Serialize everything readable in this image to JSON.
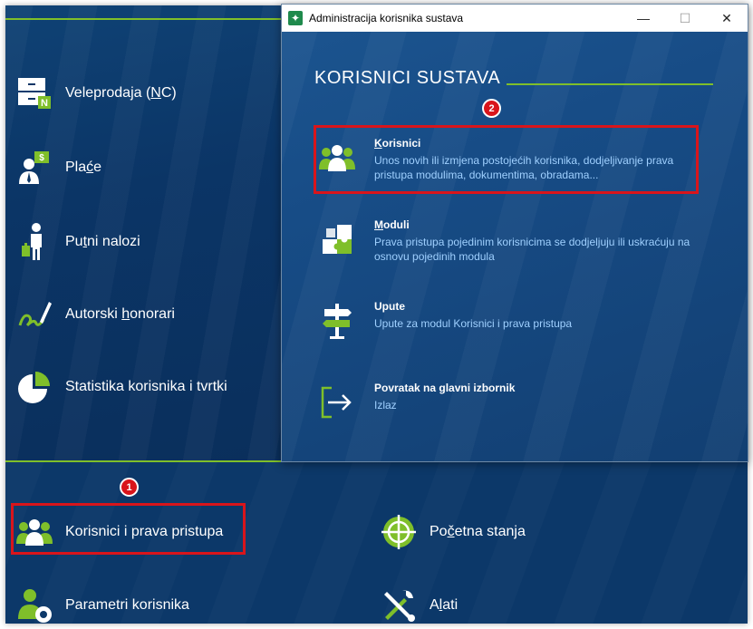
{
  "left_menu": {
    "items": [
      {
        "pre": "Veleprodaja (",
        "acc": "N",
        "post": "C)",
        "icon": "warehouse-icon"
      },
      {
        "pre": "Pla",
        "acc": "ć",
        "post": "e",
        "icon": "salary-icon"
      },
      {
        "pre": "Pu",
        "acc": "t",
        "post": "ni nalozi",
        "icon": "travel-icon"
      },
      {
        "pre": "Autorski ",
        "acc": "h",
        "post": "onorari",
        "icon": "signature-icon"
      },
      {
        "pre": "Statistika korisnika i tvrtki",
        "acc": "",
        "post": "",
        "icon": "pie-chart-icon"
      }
    ]
  },
  "bottom_menu": {
    "users": {
      "label": "Korisnici i prava pristupa",
      "icon": "users-icon"
    },
    "params": {
      "label": "Parametri korisnika",
      "icon": "user-settings-icon"
    },
    "initial": {
      "pre": "Po",
      "acc": "č",
      "post": "etna stanja",
      "icon": "target-icon"
    },
    "tools": {
      "pre": "A",
      "acc": "l",
      "post": "ati",
      "icon": "tools-icon"
    }
  },
  "window": {
    "title": "Administracija korisnika sustava",
    "minimize": "—",
    "maximize": "☐",
    "close": "✕",
    "heading": "KORISNICI SUSTAVA",
    "entries": [
      {
        "acc": "K",
        "rest": "orisnici",
        "desc": "Unos novih ili izmjena postojećih korisnika, dodjeljivanje prava pristupa modulima, dokumentima, obradama...",
        "icon": "users-icon"
      },
      {
        "acc": "M",
        "rest": "oduli",
        "desc": "Prava pristupa pojedinim korisnicima se dodjeljuju ili uskraćuju na osnovu pojedinih modula",
        "icon": "puzzle-icon"
      },
      {
        "acc": "",
        "rest": "Upute",
        "desc": "Upute za modul Korisnici i prava pristupa",
        "icon": "signpost-icon"
      },
      {
        "acc": "",
        "rest": "Povratak na glavni izbornik",
        "desc": "Izlaz",
        "icon": "exit-icon"
      }
    ]
  },
  "annotations": {
    "badge1": "1",
    "badge2": "2"
  },
  "colors": {
    "accent_green": "#7fbf2a",
    "highlight_red": "#d9151b",
    "link_blue": "#9fd0ff",
    "background_navy": "#0e3a6b"
  }
}
